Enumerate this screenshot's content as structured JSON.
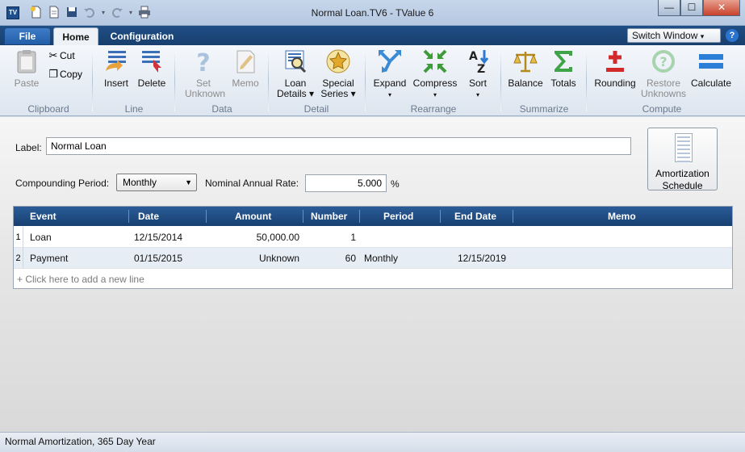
{
  "window": {
    "title": "Normal Loan.TV6 - TValue 6",
    "app_icon": "TV",
    "controls": {
      "minimize": "—",
      "maximize": "☐",
      "close": "✕"
    }
  },
  "quick_access": [
    "new-icon",
    "open-icon",
    "save-icon",
    "undo-icon",
    "redo-icon",
    "print-icon"
  ],
  "tabs": {
    "file": "File",
    "home": "Home",
    "configuration": "Configuration"
  },
  "switch_window": {
    "label": "Switch Window",
    "arrow": "▾"
  },
  "help": "?",
  "ribbon": {
    "clipboard": {
      "label": "Clipboard",
      "paste": "Paste",
      "cut": "Cut",
      "copy": "Copy"
    },
    "line": {
      "label": "Line",
      "insert": "Insert",
      "delete": "Delete"
    },
    "data": {
      "label": "Data",
      "set_unknown": "Set Unknown",
      "memo": "Memo"
    },
    "detail": {
      "label": "Detail",
      "loan_details": "Loan Details ▾",
      "special_series": "Special Series ▾"
    },
    "rearrange": {
      "label": "Rearrange",
      "expand": "Expand",
      "compress": "Compress",
      "sort": "Sort",
      "dropdown": "▾"
    },
    "summarize": {
      "label": "Summarize",
      "balance": "Balance",
      "totals": "Totals"
    },
    "compute": {
      "label": "Compute",
      "rounding": "Rounding",
      "restore_unknowns": "Restore Unknowns",
      "calculate": "Calculate"
    }
  },
  "form": {
    "label_caption": "Label:",
    "label_value": "Normal Loan",
    "compounding_caption": "Compounding Period:",
    "compounding_value": "Monthly",
    "rate_caption": "Nominal Annual Rate:",
    "rate_value": "5.000",
    "rate_unit": "%",
    "amortization_button": "Amortization Schedule"
  },
  "grid": {
    "columns": {
      "event": "Event",
      "date": "Date",
      "amount": "Amount",
      "number": "Number",
      "period": "Period",
      "end_date": "End Date",
      "memo": "Memo"
    },
    "rows": [
      {
        "num": "1",
        "event": "Loan",
        "date": "12/15/2014",
        "amount": "50,000.00",
        "number": "1",
        "period": "",
        "end_date": "",
        "memo": ""
      },
      {
        "num": "2",
        "event": "Payment",
        "date": "01/15/2015",
        "amount": "Unknown",
        "number": "60",
        "period": "Monthly",
        "end_date": "12/15/2019",
        "memo": ""
      }
    ],
    "add_line": "+   Click here to add a new line"
  },
  "status": "Normal Amortization, 365 Day Year"
}
